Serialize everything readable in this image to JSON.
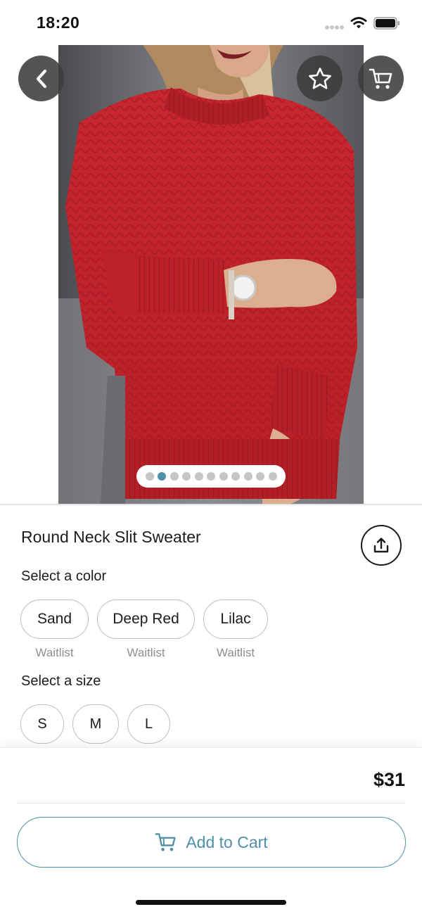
{
  "status_bar": {
    "time": "18:20"
  },
  "product": {
    "title": "Round Neck Slit Sweater",
    "image_count": 11,
    "active_image_index": 1
  },
  "colors": {
    "label": "Select a color",
    "options": [
      {
        "name": "Sand",
        "status": "Waitlist"
      },
      {
        "name": "Deep Red",
        "status": "Waitlist"
      },
      {
        "name": "Lilac",
        "status": "Waitlist"
      }
    ]
  },
  "sizes": {
    "label": "Select a size",
    "options": [
      "S",
      "M",
      "L"
    ]
  },
  "purchase": {
    "price": "$31",
    "add_to_cart_label": "Add to Cart"
  },
  "icons": {
    "back": "chevron-left-icon",
    "favorite": "star-icon",
    "cart": "cart-icon",
    "share": "share-icon"
  },
  "colors_theme": {
    "accent": "#4f8fa8",
    "sweater": "#c8232b",
    "overlay_button": "#3c3c3c"
  }
}
